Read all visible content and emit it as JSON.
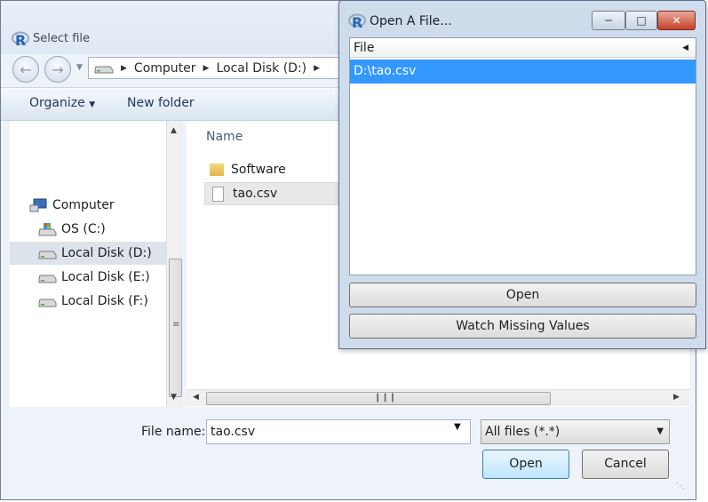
{
  "select_dialog": {
    "title": "Select file",
    "breadcrumb": [
      "Computer",
      "Local Disk (D:)"
    ],
    "toolbar": {
      "organize_label": "Organize",
      "new_folder_label": "New folder"
    },
    "nav_tree": [
      {
        "label": "Computer",
        "icon": "computer-icon",
        "selected": false
      },
      {
        "label": "OS (C:)",
        "icon": "os-drive-icon",
        "selected": false
      },
      {
        "label": "Local Disk (D:)",
        "icon": "drive-icon",
        "selected": true
      },
      {
        "label": "Local Disk (E:)",
        "icon": "drive-icon",
        "selected": false
      },
      {
        "label": "Local Disk (F:)",
        "icon": "drive-icon",
        "selected": false
      }
    ],
    "file_list": {
      "column_header": "Name",
      "items": [
        {
          "name": "Software",
          "icon": "folder-icon",
          "selected": false
        },
        {
          "name": "tao.csv",
          "icon": "document-icon",
          "selected": true
        }
      ]
    },
    "file_name_label": "File name:",
    "file_name_value": "tao.csv",
    "file_type_value": "All files (*.*)",
    "open_label": "Open",
    "cancel_label": "Cancel"
  },
  "open_file_dialog": {
    "title": "Open A File...",
    "column_header": "File",
    "rows": [
      "D:\\tao.csv"
    ],
    "open_label": "Open",
    "watch_missing_label": "Watch Missing Values"
  },
  "colors": {
    "selection_blue": "#3399ff",
    "dialog_background": "#eef3fa",
    "title_frame": "#cfdcec",
    "close_button_red": "#c4412a"
  }
}
